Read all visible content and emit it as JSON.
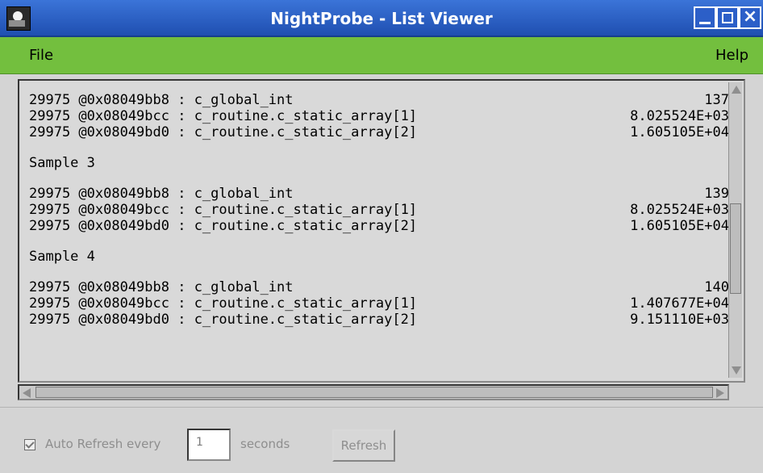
{
  "window": {
    "title": "NightProbe - List Viewer"
  },
  "menus": {
    "file": "File",
    "help": "Help"
  },
  "list": {
    "rows1": [
      {
        "line": "29975 @0x08049bb8 : c_global_int",
        "value": "137"
      },
      {
        "line": "29975 @0x08049bcc : c_routine.c_static_array[1]",
        "value": "8.025524E+03"
      },
      {
        "line": "29975 @0x08049bd0 : c_routine.c_static_array[2]",
        "value": "1.605105E+04"
      }
    ],
    "sample3": "Sample 3",
    "rows2": [
      {
        "line": "29975 @0x08049bb8 : c_global_int",
        "value": "139"
      },
      {
        "line": "29975 @0x08049bcc : c_routine.c_static_array[1]",
        "value": "8.025524E+03"
      },
      {
        "line": "29975 @0x08049bd0 : c_routine.c_static_array[2]",
        "value": "1.605105E+04"
      }
    ],
    "sample4": "Sample 4",
    "rows3": [
      {
        "line": "29975 @0x08049bb8 : c_global_int",
        "value": "140"
      },
      {
        "line": "29975 @0x08049bcc : c_routine.c_static_array[1]",
        "value": "1.407677E+04"
      },
      {
        "line": "29975 @0x08049bd0 : c_routine.c_static_array[2]",
        "value": "9.151110E+03"
      }
    ]
  },
  "footer": {
    "auto_refresh_label": "Auto Refresh every",
    "seconds_value": "1",
    "seconds_label": "seconds",
    "refresh_label": "Refresh"
  }
}
